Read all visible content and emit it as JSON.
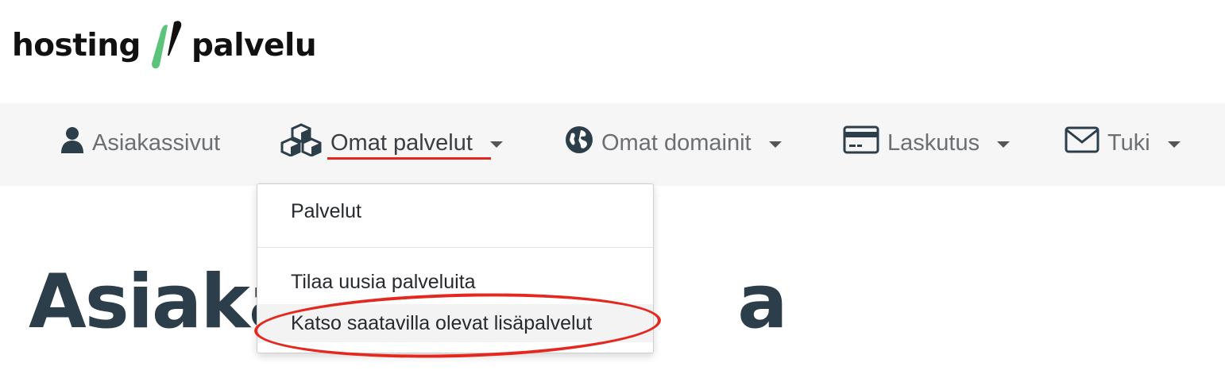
{
  "logo": {
    "left": "hosting",
    "right": "palvelu",
    "mark_color": "#5cc37a"
  },
  "nav": {
    "items": [
      {
        "label": "Asiakassivut",
        "icon": "user-icon"
      },
      {
        "label": "Omat palvelut",
        "icon": "cubes-icon"
      },
      {
        "label": "Omat domainit",
        "icon": "globe-icon"
      },
      {
        "label": "Laskutus",
        "icon": "credit-card-icon"
      },
      {
        "label": "Tuki",
        "icon": "envelope-icon"
      }
    ],
    "active_underline_color": "#e4281f"
  },
  "dropdown": {
    "items": [
      {
        "label": "Palvelut"
      },
      {
        "label": "Tilaa uusia palveluita"
      },
      {
        "label": "Katso saatavilla olevat lisäpalvelut"
      }
    ]
  },
  "page": {
    "title_visible": "Asiakas",
    "title_tail": "a"
  },
  "annotation": {
    "color": "#e4281f"
  }
}
